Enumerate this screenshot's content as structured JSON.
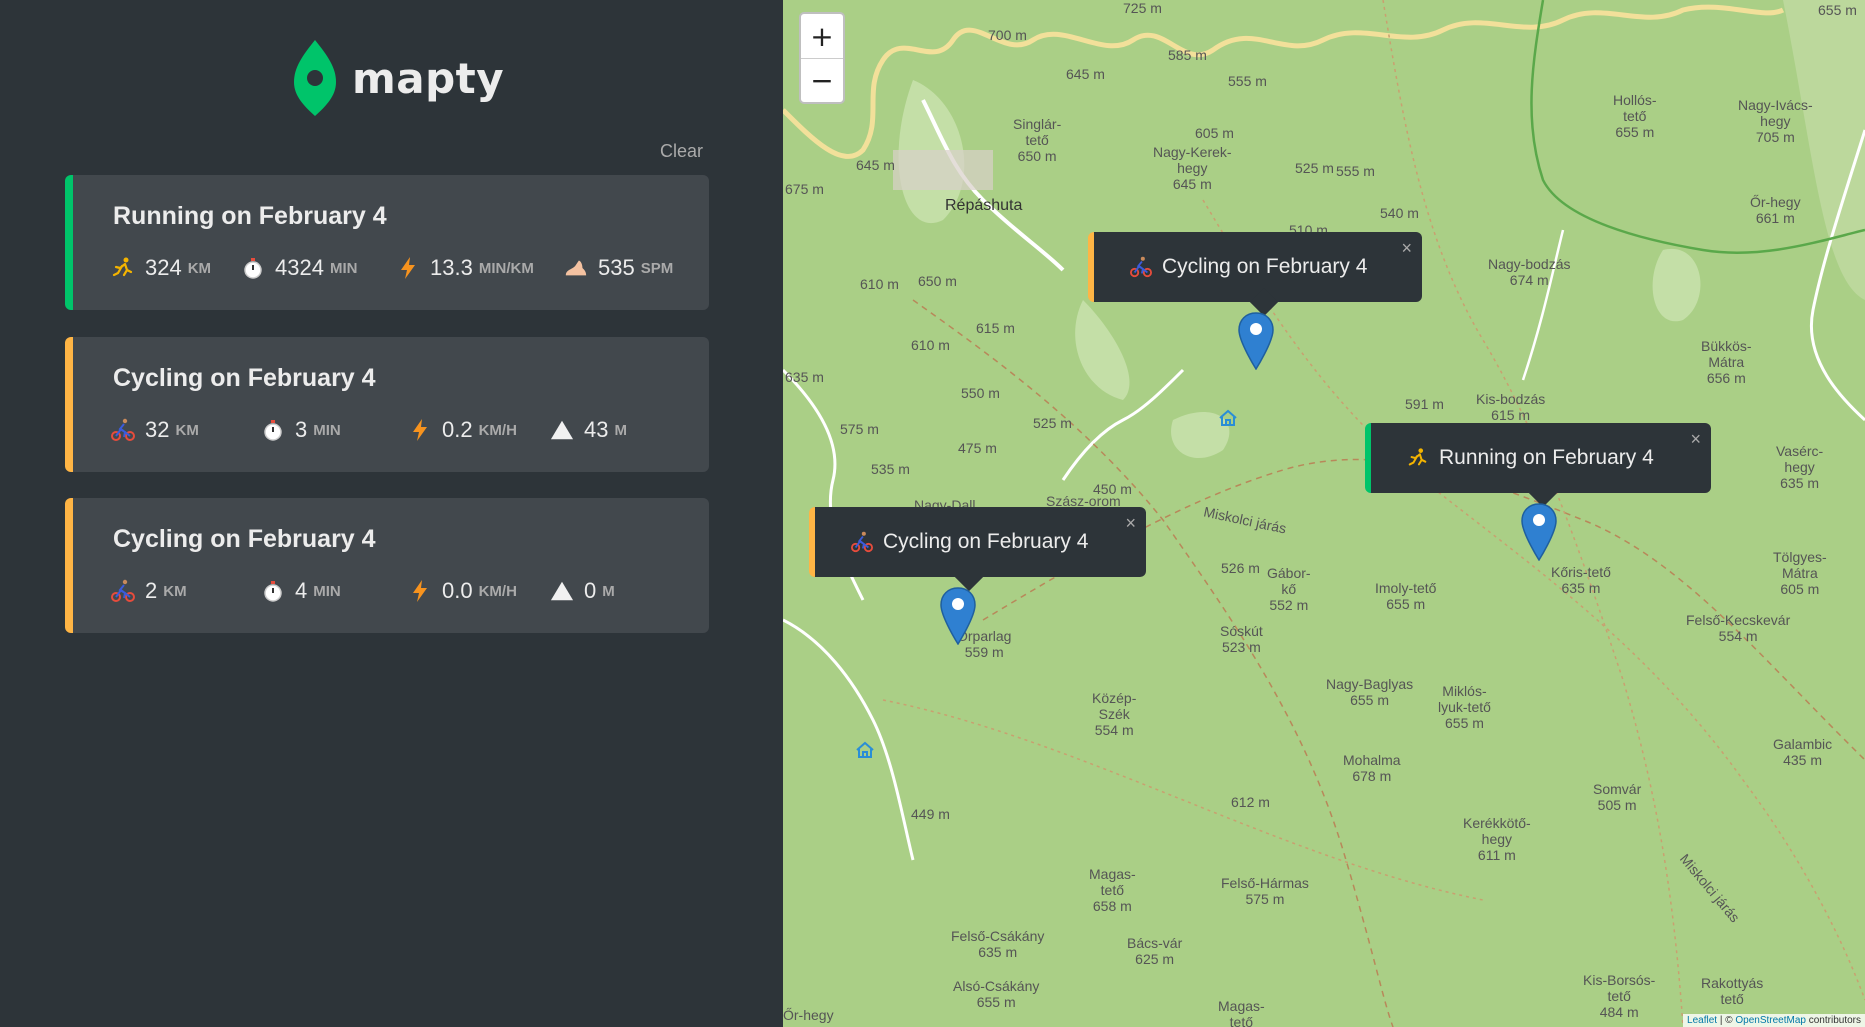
{
  "app": {
    "name": "mapty",
    "clear_label": "Clear",
    "accent_running": "#00c46a",
    "accent_cycling": "#ffb545"
  },
  "workouts": [
    {
      "type": "running",
      "title": "Running on February 4",
      "details": [
        {
          "icon": "running-icon",
          "value": "324",
          "unit": "KM"
        },
        {
          "icon": "stopwatch-icon",
          "value": "4324",
          "unit": "MIN"
        },
        {
          "icon": "lightning-icon",
          "value": "13.3",
          "unit": "MIN/KM"
        },
        {
          "icon": "foot-icon",
          "value": "535",
          "unit": "SPM"
        }
      ]
    },
    {
      "type": "cycling",
      "title": "Cycling on February 4",
      "details": [
        {
          "icon": "cycling-icon",
          "value": "32",
          "unit": "KM"
        },
        {
          "icon": "stopwatch-icon",
          "value": "3",
          "unit": "MIN"
        },
        {
          "icon": "lightning-icon",
          "value": "0.2",
          "unit": "KM/H"
        },
        {
          "icon": "mountain-icon",
          "value": "43",
          "unit": "M"
        }
      ]
    },
    {
      "type": "cycling",
      "title": "Cycling on February 4",
      "details": [
        {
          "icon": "cycling-icon",
          "value": "2",
          "unit": "KM"
        },
        {
          "icon": "stopwatch-icon",
          "value": "4",
          "unit": "MIN"
        },
        {
          "icon": "lightning-icon",
          "value": "0.0",
          "unit": "KM/H"
        },
        {
          "icon": "mountain-icon",
          "value": "0",
          "unit": "M"
        }
      ]
    }
  ],
  "map": {
    "zoom_in": "+",
    "zoom_out": "−",
    "popups": [
      {
        "type": "cycling",
        "icon": "cycling-icon",
        "label": "Cycling on February 4"
      },
      {
        "type": "running",
        "icon": "running-icon",
        "label": "Running on February 4"
      },
      {
        "type": "cycling",
        "icon": "cycling-icon",
        "label": "Cycling on February 4"
      }
    ],
    "close_glyph": "×",
    "labels": {
      "l1": "725 m",
      "l2": "700 m",
      "l3": "585 m",
      "l4": "645 m",
      "l5": "555 m",
      "l6": "Singlár-\ntető\n650 m",
      "l7": "605 m",
      "l8": "Nagy-Kerek-\nhegy\n645 m",
      "l9": "525 m",
      "l10": "555 m",
      "l11": "Hollós-\ntető\n655 m",
      "l12": "Nagy-Ivács-\nhegy\n705 m",
      "l13": "Répáshuta",
      "l14": "645 m",
      "l15": "675 m",
      "l16": "540 m",
      "l17": "510 m",
      "l18": "Őr-hegy\n661 m",
      "l19": "Nagy-bodzás\n674 m",
      "l20": "610 m",
      "l21": "650 m",
      "l22": "615 m",
      "l23": "610 m",
      "l24": "550 m",
      "l25": "635 m",
      "l26": "Bükkös-\nMátra\n656 m",
      "l27": "591 m",
      "l28": "Kis-bodzás\n615 m",
      "l29": "575 m",
      "l30": "525 m",
      "l31": "475 m",
      "l32": "535 m",
      "l33": "Vasérc-\nhegy\n635 m",
      "l34": "Nagy-Dall",
      "l35": "Szász-orom",
      "l36": "450 m",
      "l37": "Miskolci járás",
      "l38": "Tölgyes-\nMátra\n605 m",
      "l39": "526 m",
      "l40": "Gábor-\nkő\n552 m",
      "l41": "Imoly-tető\n655 m",
      "l42": "Kőris-tető\n635 m",
      "l43": "Felső-Kecskevár\n554 m",
      "l44": "Őrparlag\n559 m",
      "l45": "Sóskút\n523 m",
      "l46": "Nagy-Baglyas\n655 m",
      "l47": "Miklós-\nlyuk-tető\n655 m",
      "l48": "Közép-\nSzék\n554 m",
      "l49": "Galambic\n435 m",
      "l50": "Mohalma\n678 m",
      "l51": "612 m",
      "l52": "Somvár\n505 m",
      "l53": "449 m",
      "l54": "Kerékkötő-\nhegy\n611 m",
      "l55": "Magas-\ntető\n658 m",
      "l56": "Felső-Hármas\n575 m",
      "l57": "Felső-Csákány\n635 m",
      "l58": "Bács-vár\n625 m",
      "l59": "Alsó-Csákány\n655 m",
      "l60": "Magas-\ntető",
      "l61": "Kis-Borsós-\ntető\n484 m",
      "l62": "Rakottyás\ntető",
      "l63": "Őr-hegy",
      "l64": "655 m",
      "l65": "Miskolci járás"
    },
    "attribution_leaflet": "Leaflet",
    "attribution_sep": " | © ",
    "attribution_osm": "OpenStreetMap",
    "attribution_tail": " contributors"
  }
}
